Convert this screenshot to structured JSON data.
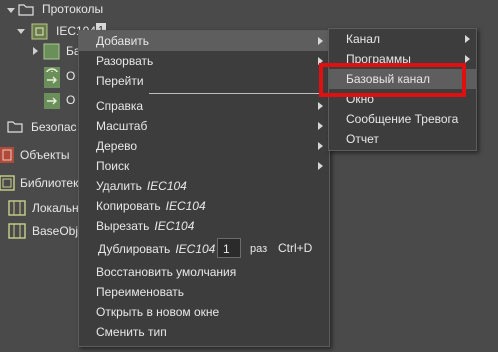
{
  "tree": {
    "protocols_label": "Протоколы",
    "iec_label": "IEC104",
    "iec_badge": "1",
    "child1_label": "Ба",
    "child2_label": "О",
    "child3_label": "О",
    "security_label": "Безопас",
    "objects_label": "Объекты",
    "libraries_label": "Библиотек",
    "local_label": "Локальн",
    "baseobj_label": "BaseObje"
  },
  "context_menu": {
    "object_name": "IEC104",
    "add": "Добавить",
    "unfold": "Разорвать",
    "goto": "Перейти",
    "help": "Справка",
    "scale": "Масштаб",
    "tree": "Дерево",
    "search": "Поиск",
    "delete": "Удалить",
    "copy": "Копировать",
    "cut": "Вырезать",
    "duplicate": "Дублировать",
    "duplicate_count": "1",
    "duplicate_unit": "раз",
    "duplicate_shortcut": "Ctrl+D",
    "restore": "Восстановить умолчания",
    "rename": "Переименовать",
    "open_new": "Открыть в новом окне",
    "change_type": "Сменить тип"
  },
  "submenu": {
    "channel": "Канал",
    "programs": "Программы",
    "base_channel": "Базовый канал",
    "window": "Окно",
    "alarm_message": "Сообщение Тревога",
    "report": "Отчет"
  },
  "colors": {
    "background": "#4a4a4a",
    "menu_bg": "#3d3d3d",
    "highlight_item": "#5e5e5e",
    "annotation_red": "#e01010"
  }
}
